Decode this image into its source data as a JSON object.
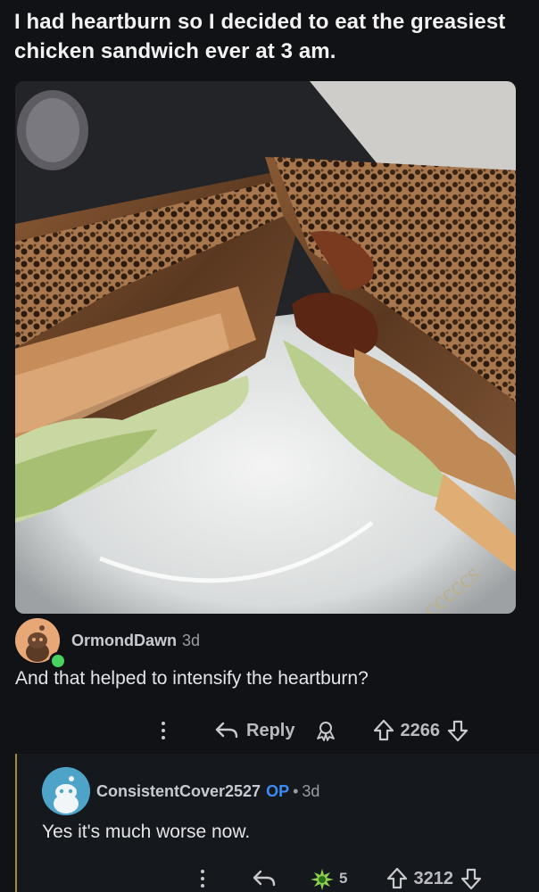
{
  "post": {
    "title": "I had heartburn so I decided to eat the greasiest chicken sandwich ever at 3 am."
  },
  "comments": [
    {
      "username": "OrmondDawn",
      "age": "3d",
      "body": "And that helped to intensify the heartburn?",
      "reply_label": "Reply",
      "votes": "2266",
      "avatar_color": "#e7a777",
      "online": true
    },
    {
      "username": "ConsistentCover2527",
      "op_label": "OP",
      "separator": "•",
      "age": "3d",
      "body": "Yes it's much worse now.",
      "award_count": "5",
      "votes": "3212",
      "avatar_color": "#4ea3c9"
    }
  ],
  "colors": {
    "background": "#111216",
    "op_blue": "#3b8df5",
    "thread_line": "#a68a3a",
    "online_green": "#46d160"
  },
  "icons": [
    "more-icon",
    "reply-arrow-icon",
    "award-icon",
    "upvote-icon",
    "downvote-icon",
    "snoo-avatar-icon"
  ]
}
